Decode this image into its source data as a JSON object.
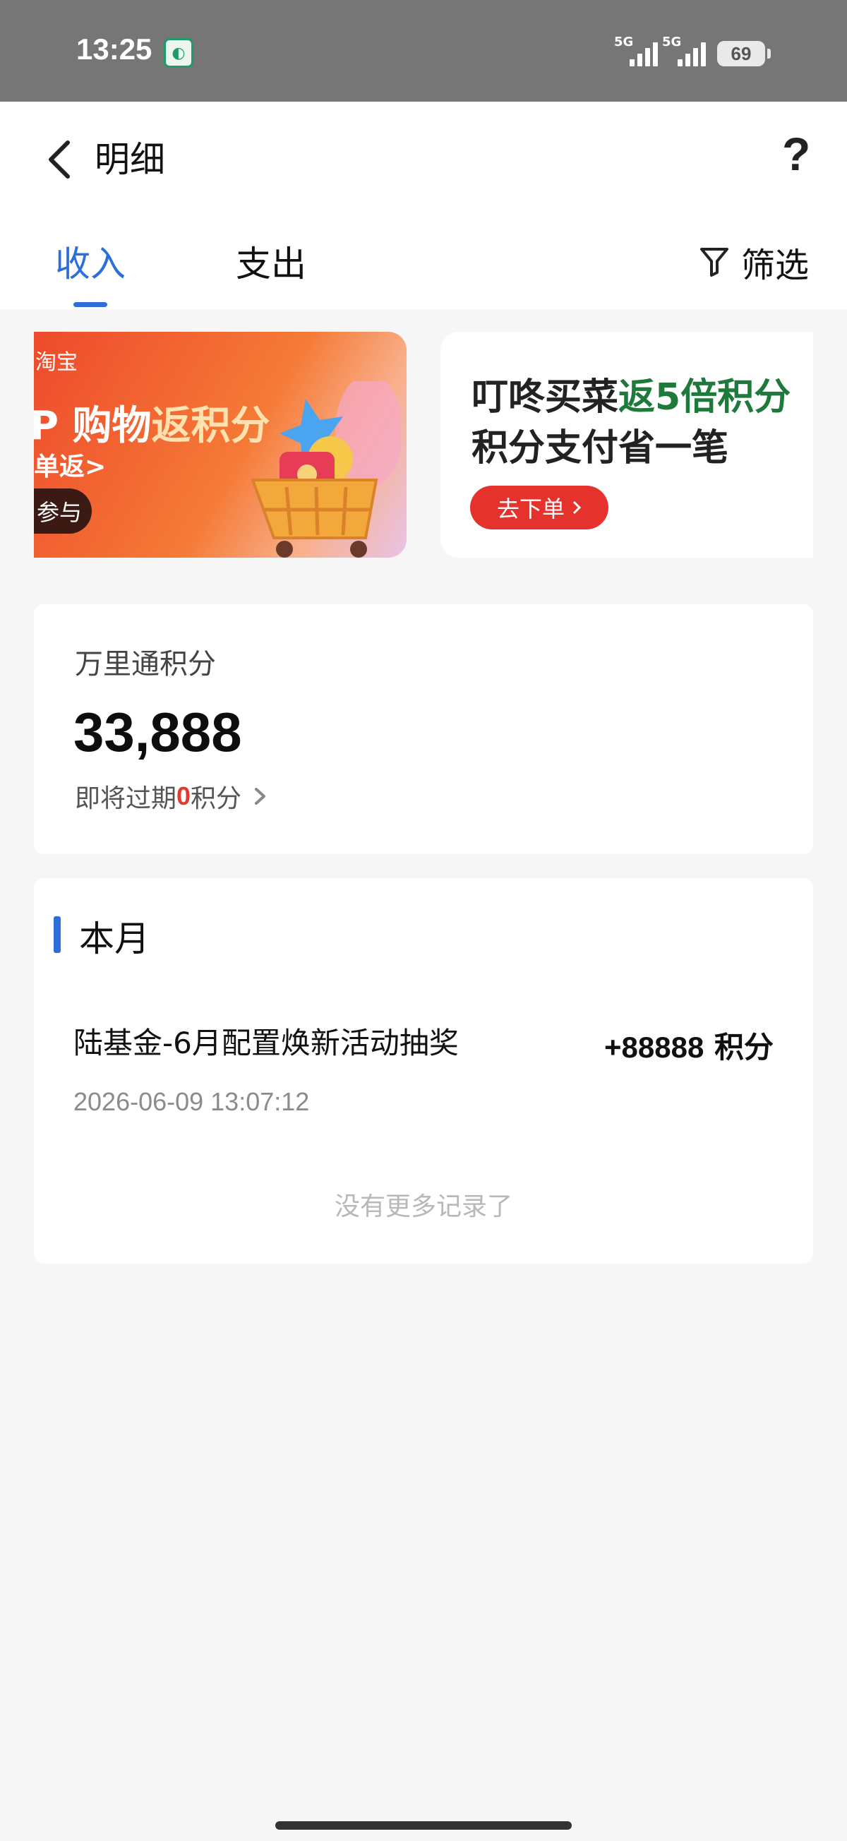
{
  "status_bar": {
    "time": "13:25",
    "app_icon": "green-circle-app-icon",
    "signal_1": "5G",
    "signal_2": "5G",
    "battery": "69"
  },
  "header": {
    "title": "明细",
    "help": "?",
    "tabs": [
      {
        "label": "收入",
        "active": true
      },
      {
        "label": "支出",
        "active": false
      }
    ],
    "filter_label": "筛选"
  },
  "banners": {
    "taobao": {
      "brand": "淘宝",
      "title_prefix": "P 购物",
      "title_highlight": "返积分",
      "subtitle": "单返>",
      "button": "参与"
    },
    "dingdong": {
      "line1_prefix": "叮咚买菜",
      "line1_highlight": "返5倍积分",
      "line2": "积分支付省一笔",
      "button": "去下单"
    }
  },
  "points": {
    "label": "万里通积分",
    "value": "33,888",
    "expire_prefix": "即将过期",
    "expire_count": "0",
    "expire_suffix": "积分"
  },
  "records": {
    "month": "本月",
    "items": [
      {
        "title": "陆基金-6月配置焕新活动抽奖",
        "amount": "+88888",
        "unit": "积分",
        "time": "2026-06-09 13:07:12"
      }
    ],
    "no_more": "没有更多记录了"
  },
  "colors": {
    "accent": "#2b6fdb",
    "status_bar": "#767676",
    "expire_red": "#e23a2f",
    "dingdong_green": "#1d7a3b",
    "dingdong_button": "#e5322d"
  }
}
